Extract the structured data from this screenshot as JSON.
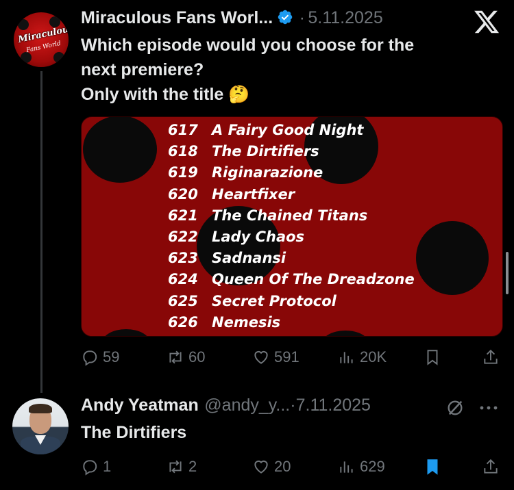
{
  "tweet": {
    "author_name": "Miraculous Fans Worl...",
    "separator": "·",
    "date": "5.11.2025",
    "avatar_text_1": "Miraculous",
    "avatar_text_2": "Fans World",
    "text_line_1": "Which episode would you choose for the",
    "text_line_2": "next premiere?",
    "text_line_3": "Only with the title 🤔",
    "episodes": [
      {
        "num": "617",
        "title": "A Fairy Good Night"
      },
      {
        "num": "618",
        "title": "The Dirtifiers"
      },
      {
        "num": "619",
        "title": "Riginarazione"
      },
      {
        "num": "620",
        "title": "Heartfixer"
      },
      {
        "num": "621",
        "title": "The Chained Titans"
      },
      {
        "num": "622",
        "title": "Lady Chaos"
      },
      {
        "num": "623",
        "title": "Sadnansi"
      },
      {
        "num": "624",
        "title": "Queen Of The Dreadzone"
      },
      {
        "num": "625",
        "title": "Secret Protocol"
      },
      {
        "num": "626",
        "title": "Nemesis"
      }
    ],
    "replies": "59",
    "reposts": "60",
    "likes": "591",
    "views": "20K"
  },
  "reply": {
    "author_name": "Andy Yeatman",
    "handle": "@andy_y...",
    "separator": "·",
    "date": "7.11.2025",
    "text": "The Dirtifiers",
    "replies": "1",
    "reposts": "2",
    "likes": "20",
    "views": "629",
    "bookmarked": true
  },
  "colors": {
    "background": "#000000",
    "text": "#e7e9ea",
    "muted": "#71767b",
    "verified": "#1d9bf0",
    "bookmark_active": "#1d9bf0",
    "card_red": "#880707"
  },
  "icons": [
    "x-logo-icon",
    "verified-badge-icon",
    "reply-icon",
    "repost-icon",
    "like-icon",
    "views-icon",
    "bookmark-icon",
    "share-icon",
    "grok-icon",
    "more-icon"
  ]
}
